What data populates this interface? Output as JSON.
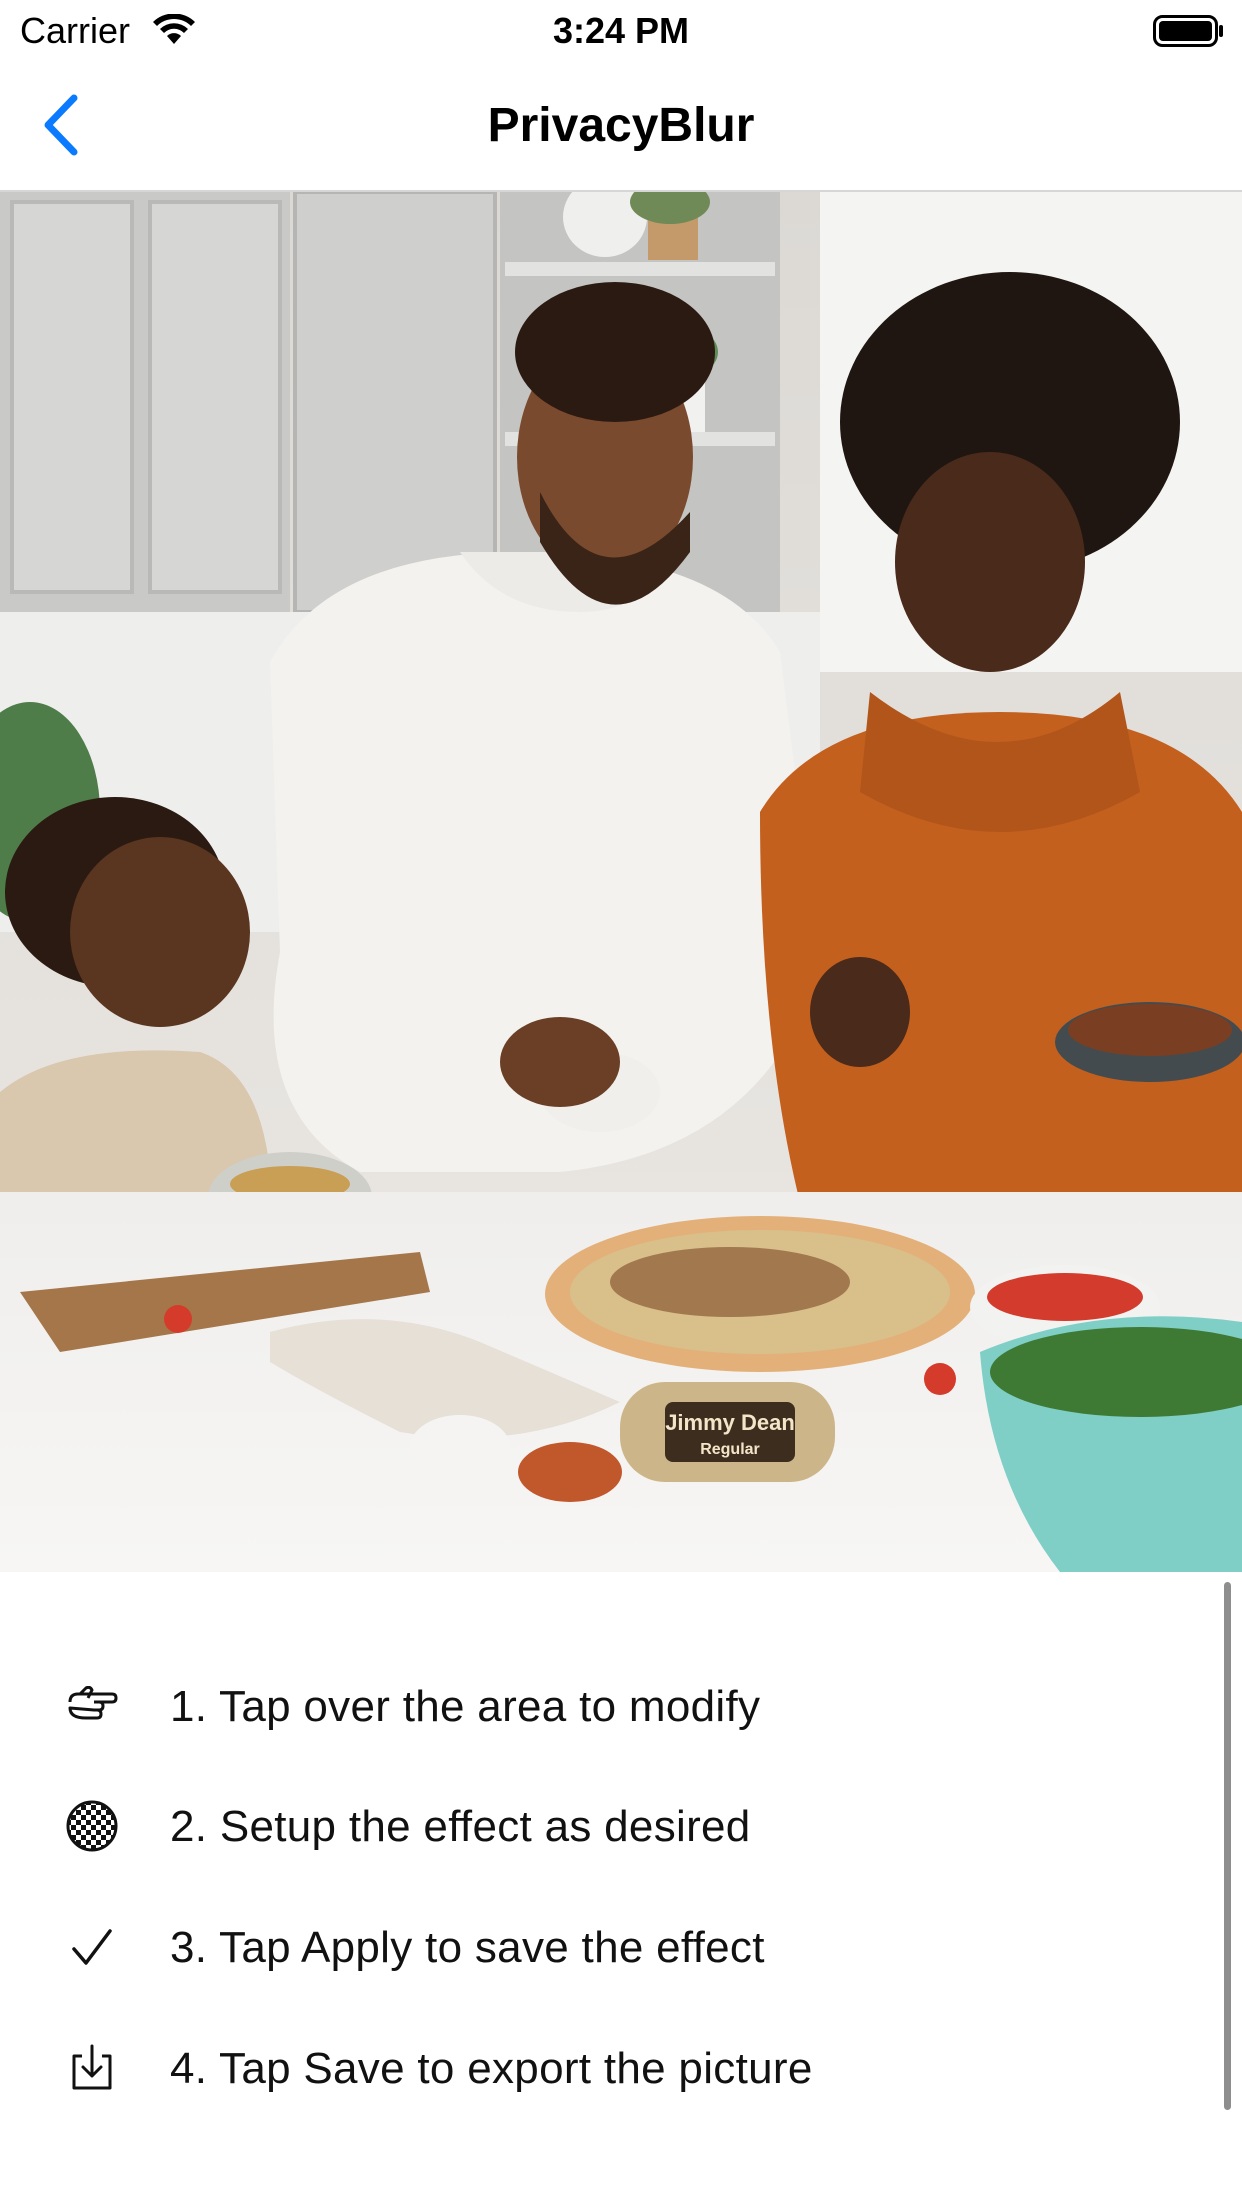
{
  "status_bar": {
    "carrier": "Carrier",
    "time": "3:24 PM"
  },
  "nav": {
    "title": "PrivacyBlur",
    "back_icon": "chevron-left-icon",
    "accent_color": "#0a7aff"
  },
  "photo": {
    "description_icon": "family-cooking-photo",
    "package_label_line1": "Jimmy Dean",
    "package_label_line2": "Regular"
  },
  "instructions": {
    "steps": [
      {
        "icon": "pointing-hand-icon",
        "label": "1. Tap over the area to modify"
      },
      {
        "icon": "checkerboard-icon",
        "label": "2. Setup the effect as desired"
      },
      {
        "icon": "checkmark-icon",
        "label": "3. Tap Apply to save the effect"
      },
      {
        "icon": "save-tray-icon",
        "label": "4. Tap Save to export the picture"
      }
    ]
  }
}
